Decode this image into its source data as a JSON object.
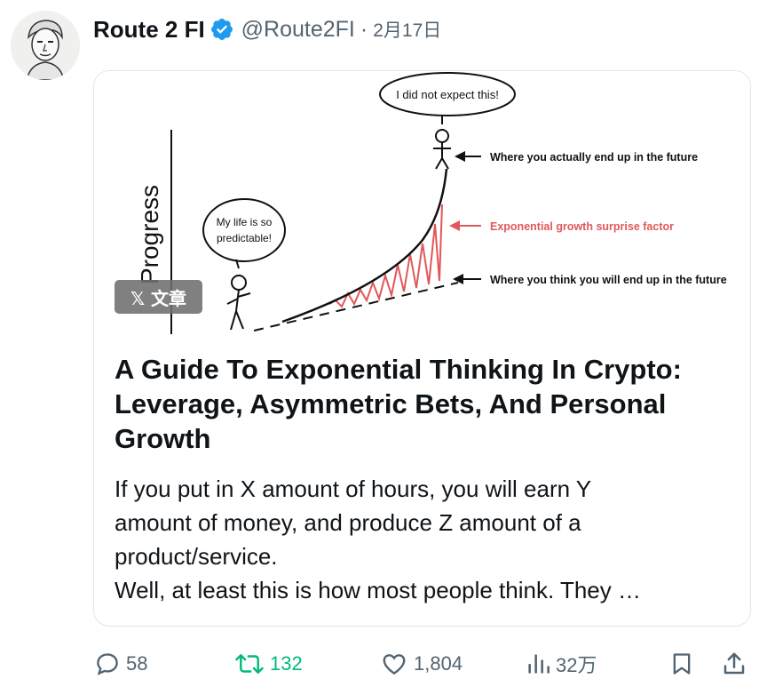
{
  "tweet": {
    "author_name": "Route 2 FI",
    "handle": "@Route2FI",
    "separator": "·",
    "timestamp": "2月17日"
  },
  "card": {
    "badge": "𝕏 文章",
    "image_labels": {
      "speech_top": "I did not expect this!",
      "speech_left_line1": "My life is so",
      "speech_left_line2": "predictable!",
      "axis": "Progress",
      "arrow_actual": "Where you actually end up in the future",
      "arrow_surprise": "Exponential growth surprise factor",
      "arrow_think": "Where you think you will end up in the future"
    },
    "title": "A Guide To Exponential Thinking In Crypto: Leverage, Asymmetric Bets, And Personal Growth",
    "excerpt_lines": [
      "If you put in X amount of hours, you will earn Y",
      "amount of money, and produce Z amount of a",
      "product/service.",
      "Well, at least this is how most people think. They …"
    ]
  },
  "actions": {
    "replies": "58",
    "reposts": "132",
    "likes": "1,804",
    "views": "32万"
  },
  "colors": {
    "text": "#0f1419",
    "secondary": "#536471",
    "verified": "#1d9bf0",
    "repost_active": "#00ba7c",
    "surprise_red": "#e0585a"
  }
}
